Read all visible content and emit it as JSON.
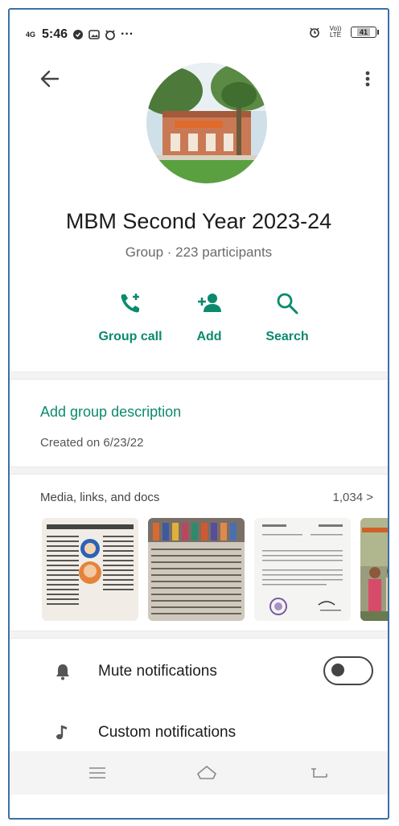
{
  "status_bar": {
    "network": "4G",
    "time": "5:46",
    "dots": "···",
    "volte": "Vo)) LTE",
    "battery": "41"
  },
  "group": {
    "name": "MBM Second Year 2023-24",
    "subtitle": "Group · 223 participants"
  },
  "actions": [
    {
      "label": "Group call",
      "icon": "group-call-icon"
    },
    {
      "label": "Add",
      "icon": "add-person-icon"
    },
    {
      "label": "Search",
      "icon": "search-icon"
    }
  ],
  "description": {
    "link": "Add group description",
    "created": "Created on 6/23/22"
  },
  "media": {
    "heading": "Media, links, and docs",
    "count": "1,034 >"
  },
  "settings": [
    {
      "label": "Mute notifications",
      "icon": "bell-icon",
      "toggle": "off"
    },
    {
      "label": "Custom notifications",
      "icon": "music-note-icon"
    }
  ],
  "colors": {
    "accent": "#0b8a6e",
    "frame": "#3d6ea8"
  }
}
